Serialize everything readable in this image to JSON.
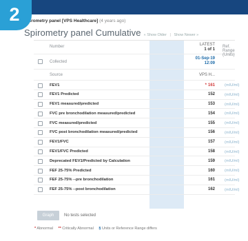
{
  "badge": {
    "number": "2"
  },
  "panel": {
    "source": "Spirometry panel [VPS Healthcare]",
    "age": "(4 years ago)",
    "title": "Spirometry panel Cumulative",
    "show_older": "« Show Older",
    "show_newer": "Show Newer »"
  },
  "headers": {
    "number": "Number",
    "collected": "Collected",
    "source": "Source",
    "latest_line1": "LATEST",
    "latest_line2": "1 of 1",
    "ref_range": "Ref. Range (Units)",
    "collected_date": "01-Sep-19",
    "collected_time": "12:09",
    "source_value": "VPS H..."
  },
  "rows": [
    {
      "name": "FEV1",
      "value": "161",
      "abnormal": true,
      "units": "(mIU/ml)"
    },
    {
      "name": "FEV1 Predicted",
      "value": "152",
      "abnormal": false,
      "units": "(mIU/ml)"
    },
    {
      "name": "FEV1 measured/predicted",
      "value": "153",
      "abnormal": false,
      "units": "(mIU/ml)"
    },
    {
      "name": "FVC pre bronchodilation measured/predicted",
      "value": "154",
      "abnormal": false,
      "units": "(mIU/ml)"
    },
    {
      "name": "FVC measured/predicted",
      "value": "155",
      "abnormal": false,
      "units": "(mIU/ml)"
    },
    {
      "name": "FVC post bronchodilation measured/predicted",
      "value": "156",
      "abnormal": false,
      "units": "(mIU/ml)"
    },
    {
      "name": "FEV1/FVC",
      "value": "157",
      "abnormal": false,
      "units": "(mIU/ml)"
    },
    {
      "name": "FEV1/FVC Predicted",
      "value": "158",
      "abnormal": false,
      "units": "(mIU/ml)"
    },
    {
      "name": "Deprecated FEV1/Predicted by Calculation",
      "value": "159",
      "abnormal": false,
      "units": "(mIU/ml)"
    },
    {
      "name": "FEF 25-75% Predicted",
      "value": "160",
      "abnormal": false,
      "units": "(mIU/ml)"
    },
    {
      "name": "FEF 25-75% --pre bronchodilation",
      "value": "161",
      "abnormal": false,
      "units": "(mIU/ml)"
    },
    {
      "name": "FEF 25-75% --post bronchodilation",
      "value": "162",
      "abnormal": false,
      "units": "(mIU/ml)"
    }
  ],
  "footer": {
    "graph_label": "Graph",
    "no_tests": "No tests selected"
  },
  "legend": {
    "abnormal_mark": "*",
    "abnormal_text": "Abnormal",
    "critical_mark": "**",
    "critical_text": "Critically Abnormal",
    "units_mark": "§",
    "units_text": "Units or Reference Range differs"
  },
  "colors": {
    "topbar": "#17467f",
    "badge": "#2aa0d6",
    "latest_column": "#ddeaf6",
    "abnormal": "#d03636",
    "link_blue": "#1c6aa8"
  }
}
